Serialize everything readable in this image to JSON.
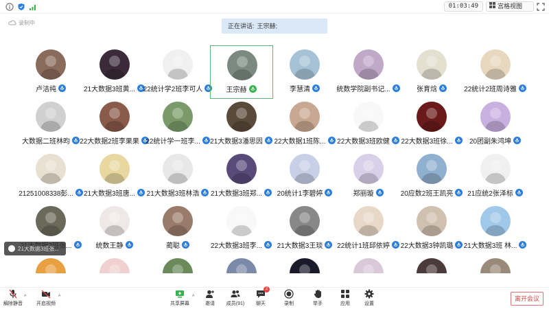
{
  "topbar": {
    "timer": "01:03:49",
    "view_label": "宫格视图",
    "icons": [
      "info-icon",
      "shield-icon",
      "signal-icon",
      "grid-icon",
      "fullscreen-icon"
    ]
  },
  "status": {
    "recording_label": "录制中",
    "speaking_prefix": "正在讲话:",
    "speaking_name": "王宗赫;"
  },
  "participants": [
    {
      "name": "卢洁纯",
      "mic": "blue",
      "bg": "#8a6a5a"
    },
    {
      "name": "21大数据3班黄...",
      "mic": "blue",
      "bg": "#3a2a3a"
    },
    {
      "name": "22统计学2班李可人",
      "mic": "blue",
      "bg": "#f0f0f0"
    },
    {
      "name": "王宗赫",
      "mic": "green",
      "bg": "#7a8a80",
      "active": true
    },
    {
      "name": "李慧清",
      "mic": "blue",
      "bg": "#a6c2d6"
    },
    {
      "name": "统数学院副书记...",
      "mic": "blue",
      "bg": "#c0a8c8"
    },
    {
      "name": "张育焓",
      "mic": "blue",
      "bg": "#e4e0d0"
    },
    {
      "name": "22统计2班周诗雅",
      "mic": "blue",
      "bg": "#e8d8c0"
    },
    {
      "name": "大数据二班林昀",
      "mic": "blue",
      "bg": "#d0d0d0"
    },
    {
      "name": "22大数据2班李果果",
      "mic": "blue",
      "bg": "#8a5a4a"
    },
    {
      "name": "22统计学一班李...",
      "mic": "blue",
      "bg": "#7a9a6a"
    },
    {
      "name": "21大数据3潘思因",
      "mic": "blue",
      "bg": "#5a4a3a"
    },
    {
      "name": "22大数据1班陈...",
      "mic": "blue",
      "bg": "#c8a890"
    },
    {
      "name": "22大数据3班欧健",
      "mic": "blue",
      "bg": "#f8f8f8"
    },
    {
      "name": "22大数据3班徐...",
      "mic": "blue",
      "bg": "#6a1a1a"
    },
    {
      "name": "20团副朱鸿坤",
      "mic": "blue",
      "bg": "#c8b0e0"
    },
    {
      "name": "21251008338彭...",
      "mic": "blue",
      "bg": "#e8e0d0"
    },
    {
      "name": "21大数据3班唐...",
      "mic": "blue",
      "bg": "#e8d8a0"
    },
    {
      "name": "21大数据3班林浩",
      "mic": "blue",
      "bg": "#e8e8e8"
    },
    {
      "name": "21大数据3班郑...",
      "mic": "blue",
      "bg": "#5a4a7a"
    },
    {
      "name": "20统计1李碧婷",
      "mic": "blue",
      "bg": "#c8d0e8"
    },
    {
      "name": "郑丽璇",
      "mic": "blue",
      "bg": "#d8d0e8"
    },
    {
      "name": "20应数2班王凯亮",
      "mic": "blue",
      "bg": "#90b0d0"
    },
    {
      "name": "21应统2张泽标",
      "mic": "blue",
      "bg": "#f0f0f0"
    },
    {
      "name": "21大数据3班张...",
      "mic": "blue",
      "bg": "#6a6a5a"
    },
    {
      "name": "统数王静",
      "mic": "blue",
      "bg": "#f0e8e8"
    },
    {
      "name": "蔺聪",
      "mic": "blue",
      "bg": "#9a7a6a"
    },
    {
      "name": "22大数据3班李...",
      "mic": "blue",
      "bg": "#f8f8f8"
    },
    {
      "name": "21大数据3王琰",
      "mic": "blue",
      "bg": "#888888"
    },
    {
      "name": "22统计1班邱依婷",
      "mic": "blue",
      "bg": "#e8d8c8"
    },
    {
      "name": "22大数据3钟凯璐",
      "mic": "blue",
      "bg": "#d0c0b0"
    },
    {
      "name": "21大数据3班 林...",
      "mic": "blue",
      "bg": "#a0c8e8"
    },
    {
      "name": "",
      "mic": "none",
      "bg": "#e8a040"
    },
    {
      "name": "",
      "mic": "none",
      "bg": "#f0d0d0"
    },
    {
      "name": "",
      "mic": "none",
      "bg": "#6a8a5a"
    },
    {
      "name": "",
      "mic": "none",
      "bg": "#7a8aa8"
    },
    {
      "name": "",
      "mic": "none",
      "bg": "#1a1a2a"
    },
    {
      "name": "",
      "mic": "none",
      "bg": "#d8c8d8"
    },
    {
      "name": "",
      "mic": "none",
      "bg": "#4a3a3a"
    },
    {
      "name": "",
      "mic": "none",
      "bg": "#9a8a7a"
    }
  ],
  "float_chat": {
    "text": "21大数据3班张..."
  },
  "toolbar": {
    "unmute": "解除静音",
    "video": "开启视频",
    "share": "共享屏幕",
    "invite": "邀请",
    "members": "成员(91)",
    "chat": "聊天",
    "chat_badge": "2",
    "record": "录制",
    "raise_hand": "举手",
    "apps": "应用",
    "settings": "设置",
    "leave": "离开会议"
  },
  "colors": {
    "accent": "#2a7de1",
    "speaking_green": "#37b24d",
    "leave_red": "#e04545",
    "speaking_bg": "#dbe8f8"
  }
}
